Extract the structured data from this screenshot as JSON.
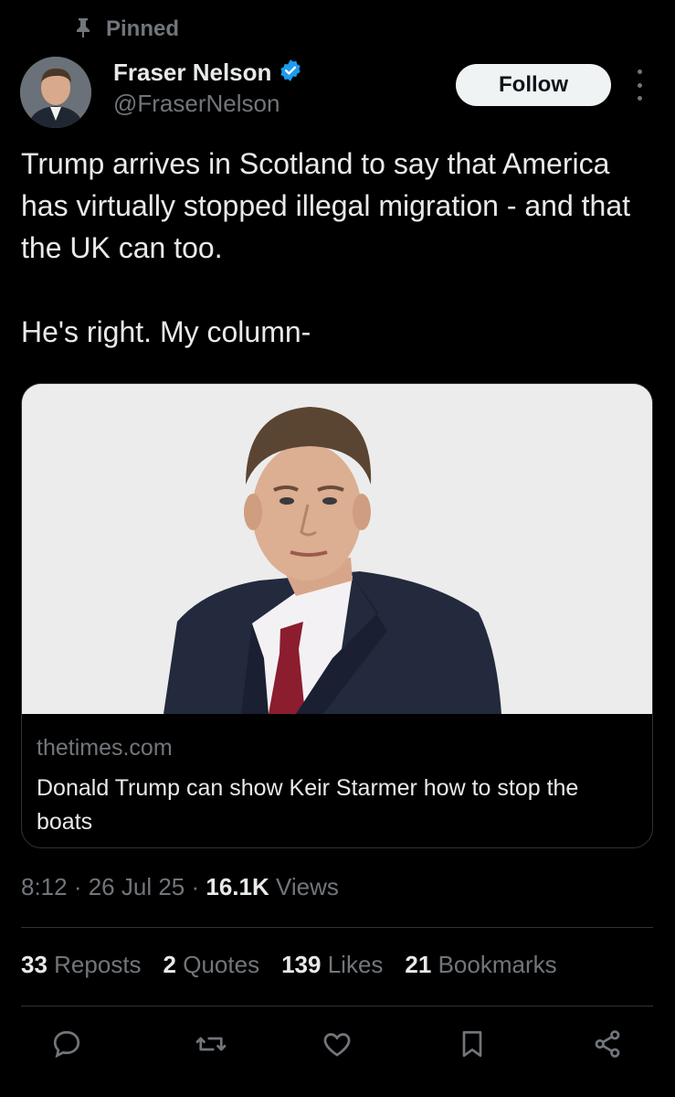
{
  "pinned": {
    "label": "Pinned",
    "icon": "pin-icon"
  },
  "author": {
    "name": "Fraser Nelson",
    "handle": "@FraserNelson",
    "verified_icon": "verified-badge-icon",
    "verified_color": "#1d9bf0"
  },
  "follow_label": "Follow",
  "tweet": {
    "lines": [
      "Trump arrives in Scotland to say that America has virtually stopped illegal migration - and that the UK can too.",
      "He's right. My column-"
    ]
  },
  "card": {
    "domain": "thetimes.com",
    "title": "Donald Trump can show Keir Starmer how to stop the boats"
  },
  "meta": {
    "time": "8:12",
    "date": "26 Jul 25",
    "views_count": "16.1K",
    "views_label": "Views",
    "separator": " · "
  },
  "stats": [
    {
      "count": "33",
      "label": "Reposts"
    },
    {
      "count": "2",
      "label": "Quotes"
    },
    {
      "count": "139",
      "label": "Likes"
    },
    {
      "count": "21",
      "label": "Bookmarks"
    }
  ],
  "actions": [
    "reply-icon",
    "repost-icon",
    "like-icon",
    "bookmark-icon",
    "share-icon"
  ],
  "colors": {
    "background": "#000000",
    "text": "#e7e9ea",
    "muted": "#71767b",
    "divider": "#2f3336",
    "accent": "#1d9bf0"
  }
}
